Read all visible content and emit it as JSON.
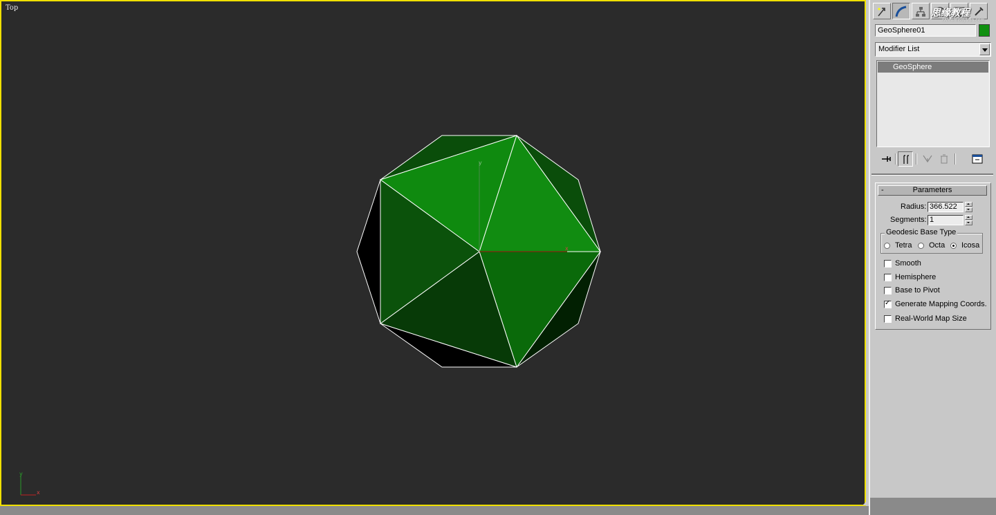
{
  "viewport": {
    "label": "Top",
    "axis_x": "x",
    "axis_y": "y",
    "border_color": "#f0e000",
    "bg": "#2b2b2b"
  },
  "command_panel": {
    "tabs": [
      "create-icon",
      "modify-icon",
      "hierarchy-icon",
      "motion-icon",
      "display-icon",
      "utilities-icon"
    ],
    "active_tab": "modify-icon",
    "watermark": "思缘教程",
    "watermark_sub": "www.missyuan.com",
    "object_name": "GeoSphere01",
    "object_color": "#109010",
    "modifier_list": "Modifier List",
    "stack_items": [
      "GeoSphere"
    ],
    "stack_tools": [
      "pin-stack-icon",
      "show-end-result-icon",
      "make-unique-icon",
      "remove-modifier-icon",
      "configure-sets-icon"
    ]
  },
  "parameters": {
    "title": "Parameters",
    "collapse": "-",
    "radius_label": "Radius:",
    "radius_value": "366.522",
    "segments_label": "Segments:",
    "segments_value": "1",
    "base_type_label": "Geodesic Base Type",
    "base_types": [
      "Tetra",
      "Octa",
      "Icosa"
    ],
    "selected_base_type": "Icosa",
    "options": [
      {
        "label": "Smooth",
        "checked": false
      },
      {
        "label": "Hemisphere",
        "checked": false
      },
      {
        "label": "Base to Pivot",
        "checked": false
      },
      {
        "label": "Generate Mapping Coords.",
        "checked": true
      },
      {
        "label": "Real-World Map Size",
        "checked": false
      }
    ]
  },
  "colors": {
    "face_light": "#108c10",
    "face_mid": "#0a6a0a",
    "face_dark": "#0a4d0a",
    "face_darker": "#073707",
    "edge": "#ffffff"
  }
}
